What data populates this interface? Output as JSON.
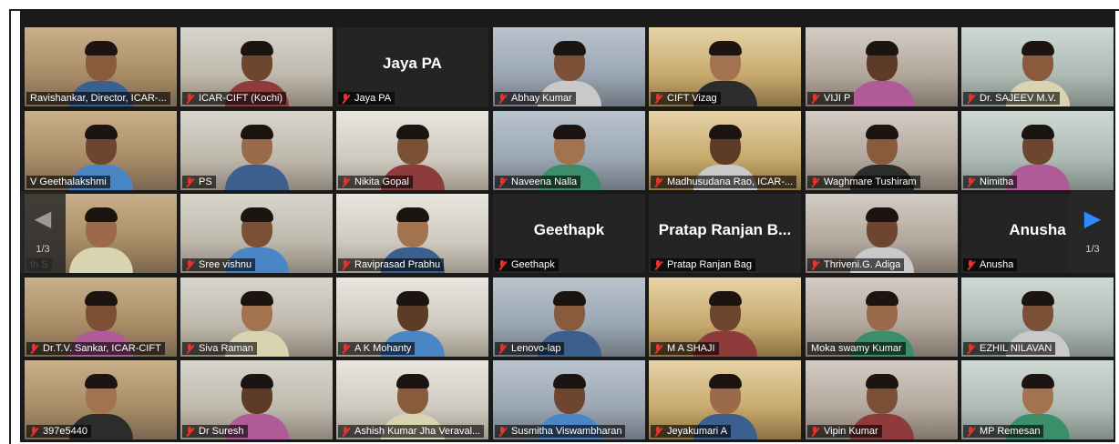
{
  "gallery": {
    "page_prev": "1/3",
    "page_next": "1/3",
    "prev_icon": "chevron-left-icon",
    "next_icon": "chevron-right-icon",
    "accent_active": "#e6e85a",
    "accent_next": "#2d8cff",
    "muted_color": "#e8322c"
  },
  "participants": [
    {
      "name": "Ravishankar, Director, ICAR-...",
      "muted": false,
      "video": true,
      "active": true
    },
    {
      "name": "ICAR-CIFT (Kochi)",
      "muted": true,
      "video": true
    },
    {
      "name": "Jaya PA",
      "muted": true,
      "video": false,
      "display": "Jaya PA"
    },
    {
      "name": "Abhay Kumar",
      "muted": true,
      "video": true
    },
    {
      "name": "CIFT Vizag",
      "muted": true,
      "video": true
    },
    {
      "name": "VIJI P",
      "muted": true,
      "video": true
    },
    {
      "name": "Dr. SAJEEV M.V.",
      "muted": true,
      "video": true
    },
    {
      "name": "V Geethalakshmi",
      "muted": false,
      "video": true
    },
    {
      "name": "PS",
      "muted": true,
      "video": true
    },
    {
      "name": "Nikita Gopal",
      "muted": true,
      "video": true
    },
    {
      "name": "Naveena Nalla",
      "muted": true,
      "video": true
    },
    {
      "name": "Madhusudana Rao, ICAR-...",
      "muted": true,
      "video": true
    },
    {
      "name": "Waghmare Tushiram",
      "muted": true,
      "video": true
    },
    {
      "name": "Nimitha",
      "muted": true,
      "video": true
    },
    {
      "name": "th S",
      "muted": false,
      "video": true
    },
    {
      "name": "Sree vishnu",
      "muted": true,
      "video": true
    },
    {
      "name": "Raviprasad Prabhu",
      "muted": true,
      "video": true
    },
    {
      "name": "Geethapk",
      "muted": true,
      "video": false,
      "display": "Geethapk"
    },
    {
      "name": "Pratap Ranjan Bag",
      "muted": true,
      "video": false,
      "display": "Pratap Ranjan B..."
    },
    {
      "name": "Thriveni.G. Adiga",
      "muted": true,
      "video": true
    },
    {
      "name": "Anusha",
      "muted": true,
      "video": false,
      "display": "Anusha"
    },
    {
      "name": "Dr.T.V. Sankar, ICAR-CIFT",
      "muted": true,
      "video": true
    },
    {
      "name": "Siva Raman",
      "muted": true,
      "video": true
    },
    {
      "name": "A K Mohanty",
      "muted": true,
      "video": true
    },
    {
      "name": "Lenovo-lap",
      "muted": true,
      "video": true
    },
    {
      "name": "M A SHAJI",
      "muted": true,
      "video": true
    },
    {
      "name": "Moka swamy Kumar",
      "muted": false,
      "video": true
    },
    {
      "name": "EZHIL NILAVAN",
      "muted": true,
      "video": true
    },
    {
      "name": "397e5440",
      "muted": true,
      "video": true
    },
    {
      "name": "Dr Suresh",
      "muted": true,
      "video": true
    },
    {
      "name": "Ashish Kumar Jha Veraval...",
      "muted": true,
      "video": true
    },
    {
      "name": "Susmitha Viswambharan",
      "muted": true,
      "video": true
    },
    {
      "name": "Jeyakumari A",
      "muted": true,
      "video": true
    },
    {
      "name": "Vipin Kumar",
      "muted": true,
      "video": true
    },
    {
      "name": "MP Remesan",
      "muted": true,
      "video": true
    }
  ]
}
